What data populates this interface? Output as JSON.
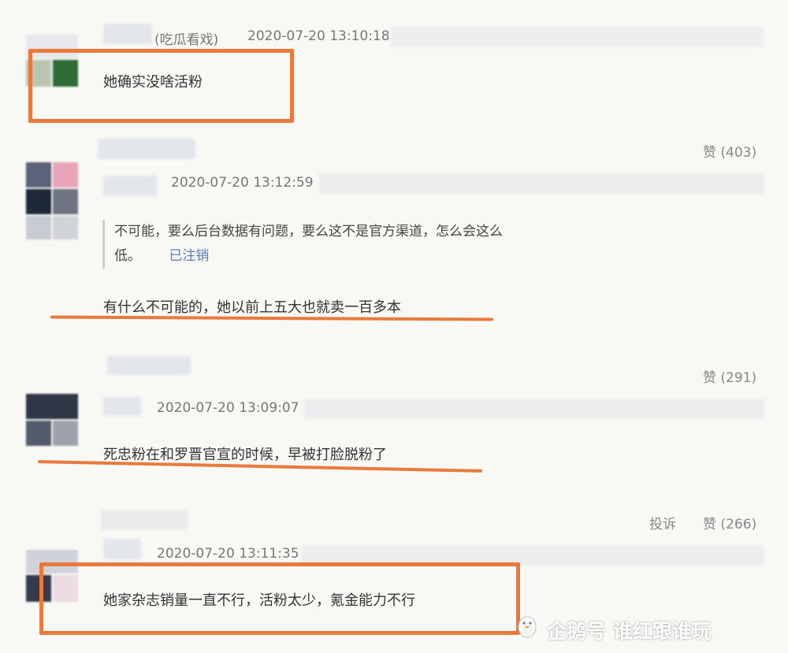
{
  "comments": [
    {
      "username": "(吃瓜看戏)",
      "timestamp": "2020-07-20 13:10:18",
      "text": "她确实没啥活粉",
      "likes": "赞 (403)"
    },
    {
      "timestamp": "2020-07-20 13:12:59",
      "quote_text": "不可能，要么后台数据有问题，要么这不是官方渠道，怎么会这么低。",
      "quote_line1": "不可能，要么后台数据有问题，要么这不是官方渠道，怎么会这么",
      "quote_line2": "低。",
      "quote_status": "已注销",
      "text": "有什么不可能的，她以前上五大也就卖一百多本",
      "likes": "赞 (291)"
    },
    {
      "timestamp": "2020-07-20 13:09:07",
      "text": "死忠粉在和罗晋官宣的时候，早被打脸脱粉了",
      "report": "投诉",
      "likes": "赞 (266)"
    },
    {
      "timestamp": "2020-07-20 13:11:35",
      "text": "她家杂志销量一直不行，活粉太少，氪金能力不行"
    }
  ],
  "watermark": "企鹅号 谁红跟谁玩",
  "colors": {
    "highlight": "#e97a3c",
    "background": "#f8f8f5",
    "meta_text": "#777777",
    "link": "#5b7fb5"
  }
}
